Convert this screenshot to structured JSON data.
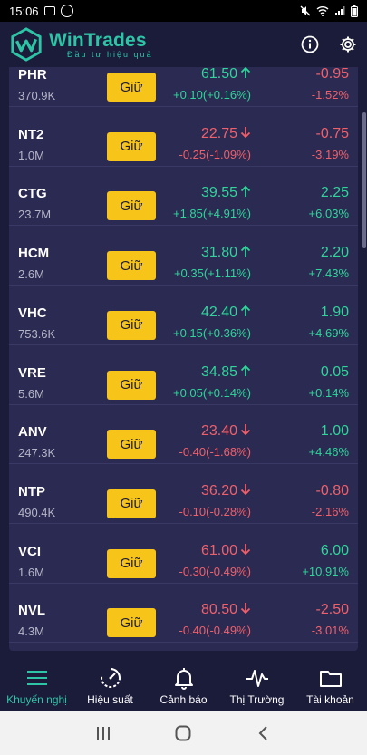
{
  "status_bar": {
    "time": "15:06",
    "battery": "🔋"
  },
  "header": {
    "brand": "WinTrades",
    "tagline": "Đầu tư hiệu quả"
  },
  "hold_label": "Giữ",
  "stocks": [
    {
      "symbol": "PHR",
      "volume": "370.9K",
      "price": "61.50",
      "price_change": "+0.10(+0.16%)",
      "trend": "up",
      "delta": "-0.95",
      "delta_pct": "-1.52%",
      "delta_trend": "down"
    },
    {
      "symbol": "NT2",
      "volume": "1.0M",
      "price": "22.75",
      "price_change": "-0.25(-1.09%)",
      "trend": "down",
      "delta": "-0.75",
      "delta_pct": "-3.19%",
      "delta_trend": "down"
    },
    {
      "symbol": "CTG",
      "volume": "23.7M",
      "price": "39.55",
      "price_change": "+1.85(+4.91%)",
      "trend": "up",
      "delta": "2.25",
      "delta_pct": "+6.03%",
      "delta_trend": "up"
    },
    {
      "symbol": "HCM",
      "volume": "2.6M",
      "price": "31.80",
      "price_change": "+0.35(+1.11%)",
      "trend": "up",
      "delta": "2.20",
      "delta_pct": "+7.43%",
      "delta_trend": "up"
    },
    {
      "symbol": "VHC",
      "volume": "753.6K",
      "price": "42.40",
      "price_change": "+0.15(+0.36%)",
      "trend": "up",
      "delta": "1.90",
      "delta_pct": "+4.69%",
      "delta_trend": "up"
    },
    {
      "symbol": "VRE",
      "volume": "5.6M",
      "price": "34.85",
      "price_change": "+0.05(+0.14%)",
      "trend": "up",
      "delta": "0.05",
      "delta_pct": "+0.14%",
      "delta_trend": "up"
    },
    {
      "symbol": "ANV",
      "volume": "247.3K",
      "price": "23.40",
      "price_change": "-0.40(-1.68%)",
      "trend": "down",
      "delta": "1.00",
      "delta_pct": "+4.46%",
      "delta_trend": "up"
    },
    {
      "symbol": "NTP",
      "volume": "490.4K",
      "price": "36.20",
      "price_change": "-0.10(-0.28%)",
      "trend": "down",
      "delta": "-0.80",
      "delta_pct": "-2.16%",
      "delta_trend": "down"
    },
    {
      "symbol": "VCI",
      "volume": "1.6M",
      "price": "61.00",
      "price_change": "-0.30(-0.49%)",
      "trend": "down",
      "delta": "6.00",
      "delta_pct": "+10.91%",
      "delta_trend": "up"
    },
    {
      "symbol": "NVL",
      "volume": "4.3M",
      "price": "80.50",
      "price_change": "-0.40(-0.49%)",
      "trend": "down",
      "delta": "-2.50",
      "delta_pct": "-3.01%",
      "delta_trend": "down"
    }
  ],
  "bottom_nav": [
    {
      "label": "Khuyến nghị",
      "icon": "menu-icon",
      "active": true
    },
    {
      "label": "Hiệu suất",
      "icon": "performance-icon",
      "active": false
    },
    {
      "label": "Cảnh báo",
      "icon": "bell-icon",
      "active": false
    },
    {
      "label": "Thị Trường",
      "icon": "pulse-icon",
      "active": false
    },
    {
      "label": "Tài khoản",
      "icon": "folder-icon",
      "active": false
    }
  ],
  "colors": {
    "up": "#2fd59a",
    "down": "#f0606b",
    "accent": "#2ec4a6",
    "button": "#f7c51a",
    "background": "#1b1b3a",
    "card": "#2b2a52"
  }
}
